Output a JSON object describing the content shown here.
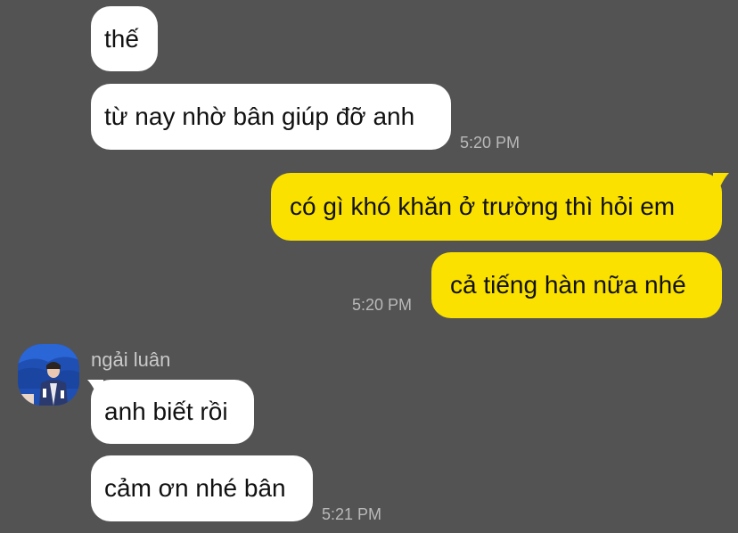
{
  "chat": {
    "messages": [
      {
        "direction": "incoming",
        "text": "thế"
      },
      {
        "direction": "incoming",
        "text": "từ nay nhờ bân giúp đỡ anh",
        "time": "5:20 PM"
      },
      {
        "direction": "outgoing",
        "text": "có gì khó khăn ở trường thì hỏi em"
      },
      {
        "direction": "outgoing",
        "text": "cả tiếng hàn nữa nhé",
        "time": "5:20 PM"
      },
      {
        "direction": "incoming",
        "sender": "ngải luân",
        "text": "anh biết rồi"
      },
      {
        "direction": "incoming",
        "text": "cảm ơn nhé bân",
        "time": "5:21 PM"
      }
    ]
  },
  "colors": {
    "background": "#545354",
    "incoming_bubble": "#ffffff",
    "outgoing_bubble": "#fae100",
    "timestamp": "#b9b9b9",
    "sender_name": "#c9c9c9"
  }
}
